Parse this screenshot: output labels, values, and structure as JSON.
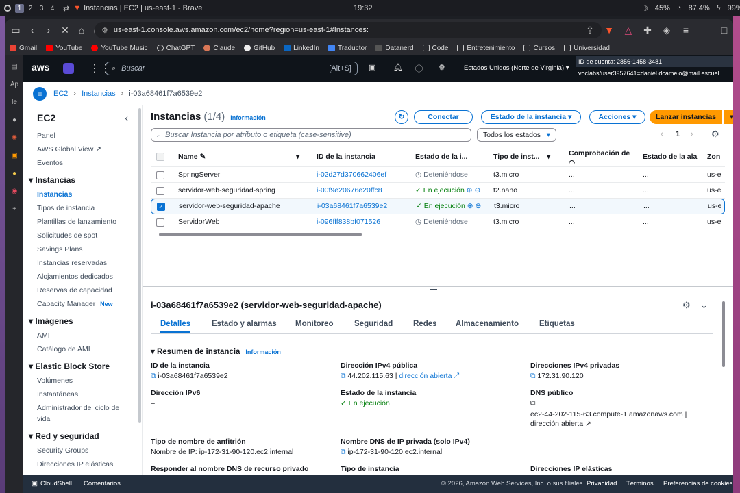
{
  "desktop": {
    "workspaces": [
      "1",
      "2",
      "3",
      "4"
    ],
    "window_title": "Instancias | EC2 | us-east-1 - Brave",
    "clock": "19:32",
    "cpu": "45%",
    "memory": "87.4%",
    "battery": "99%"
  },
  "browser": {
    "url": "us-east-1.console.aws.amazon.com/ec2/home?region=us-east-1#Instances:",
    "bookmarks": [
      "Gmail",
      "YouTube",
      "YouTube Music",
      "ChatGPT",
      "Claude",
      "GitHub",
      "LinkedIn",
      "Traductor",
      "Datanerd",
      "Code",
      "Entretenimiento",
      "Cursos",
      "Universidad"
    ],
    "side_labels": [
      "Ap",
      "le"
    ]
  },
  "aws_header": {
    "logo": "aws",
    "search_placeholder": "Buscar",
    "search_shortcut": "[Alt+S]",
    "region": "Estados Unidos (Norte de Virginia)",
    "account_id": "ID de cuenta: 2856-1458-3481",
    "user": "voclabs/user3957641=daniel.dcamelo@mail.escuel..."
  },
  "breadcrumb": {
    "ec2": "EC2",
    "instances": "Instancias",
    "current": "i-03a68461f7a6539e2"
  },
  "leftnav": {
    "title": "EC2",
    "items_top": [
      "Panel",
      "AWS Global View",
      "Eventos"
    ],
    "section_instances": "Instancias",
    "instances_items": [
      "Instancias",
      "Tipos de instancia",
      "Plantillas de lanzamiento",
      "Solicitudes de spot",
      "Savings Plans",
      "Instancias reservadas",
      "Alojamientos dedicados",
      "Reservas de capacidad",
      "Capacity Manager"
    ],
    "new_badge": "New",
    "section_images": "Imágenes",
    "images_items": [
      "AMI",
      "Catálogo de AMI"
    ],
    "section_ebs": "Elastic Block Store",
    "ebs_items": [
      "Volúmenes",
      "Instantáneas",
      "Administrador del ciclo de",
      "vida"
    ],
    "section_network": "Red y seguridad",
    "network_items": [
      "Security Groups",
      "Direcciones IP elásticas"
    ]
  },
  "instances_panel": {
    "title": "Instancias",
    "count": "(1/4)",
    "info": "Información",
    "connect": "Conectar",
    "instance_state": "Estado de la instancia",
    "actions": "Acciones",
    "launch": "Lanzar instancias",
    "search_placeholder": "Buscar Instancia por atributo o etiqueta (case-sensitive)",
    "state_filter": "Todos los estados",
    "page": "1",
    "columns": [
      "Name",
      "ID de la instancia",
      "Estado de la i...",
      "Tipo de inst...",
      "Comprobación de",
      "Estado de la ala",
      "Zon"
    ],
    "rows": [
      {
        "name": "SpringServer",
        "id": "i-02d27d370662406ef",
        "state": "Deteniéndose",
        "type": "t3.micro",
        "check": "...",
        "alarm": "...",
        "zone": "us-e",
        "selected": false,
        "running": false
      },
      {
        "name": "servidor-web-seguridad-spring",
        "id": "i-00f9e20676e20ffc8",
        "state": "En ejecución",
        "type": "t2.nano",
        "check": "...",
        "alarm": "...",
        "zone": "us-e",
        "selected": false,
        "running": true
      },
      {
        "name": "servidor-web-seguridad-apache",
        "id": "i-03a68461f7a6539e2",
        "state": "En ejecución",
        "type": "t3.micro",
        "check": "...",
        "alarm": "...",
        "zone": "us-e",
        "selected": true,
        "running": true
      },
      {
        "name": "ServidorWeb",
        "id": "i-096fff838bf071526",
        "state": "Deteniéndose",
        "type": "t3.micro",
        "check": "...",
        "alarm": "...",
        "zone": "us-e",
        "selected": false,
        "running": false
      }
    ]
  },
  "details": {
    "title": "i-03a68461f7a6539e2 (servidor-web-seguridad-apache)",
    "tabs": [
      "Detalles",
      "Estado y alarmas",
      "Monitoreo",
      "Seguridad",
      "Redes",
      "Almacenamiento",
      "Etiquetas"
    ],
    "summary_title": "Resumen de instancia",
    "summary_info": "Información",
    "instance_id_label": "ID de la instancia",
    "instance_id_value": "i-03a68461f7a6539e2",
    "public_ipv4_label": "Dirección IPv4 pública",
    "public_ipv4_value": "44.202.115.63",
    "open_address": "dirección abierta",
    "private_ipv4_label": "Direcciones IPv4 privadas",
    "private_ipv4_value": "172.31.90.120",
    "ipv6_label": "Dirección IPv6",
    "ipv6_value": "–",
    "state_label": "Estado de la instancia",
    "state_value": "En ejecución",
    "public_dns_label": "DNS público",
    "public_dns_value": "ec2-44-202-115-63.compute-1.amazonaws.com |",
    "hostname_type_label": "Tipo de nombre de anfitrión",
    "hostname_type_value": "Nombre de IP: ip-172-31-90-120.ec2.internal",
    "private_dns_label": "Nombre DNS de IP privada (solo IPv4)",
    "private_dns_value": "ip-172-31-90-120.ec2.internal",
    "elastic_ip_label": "Direcciones IP elásticas",
    "respond_dns_label": "Responder al nombre DNS de recurso privado",
    "instance_type_label": "Tipo de instancia"
  },
  "footer": {
    "cloudshell": "CloudShell",
    "comments": "Comentarios",
    "copyright": "© 2026, Amazon Web Services, Inc. o sus filiales.",
    "privacy": "Privacidad",
    "terms": "Términos",
    "cookies": "Preferencias de cookies"
  },
  "colors": {
    "aws_blue": "#0972d3",
    "aws_orange": "#ff9900",
    "running_green": "#037f0c",
    "header": "#0f141a"
  }
}
